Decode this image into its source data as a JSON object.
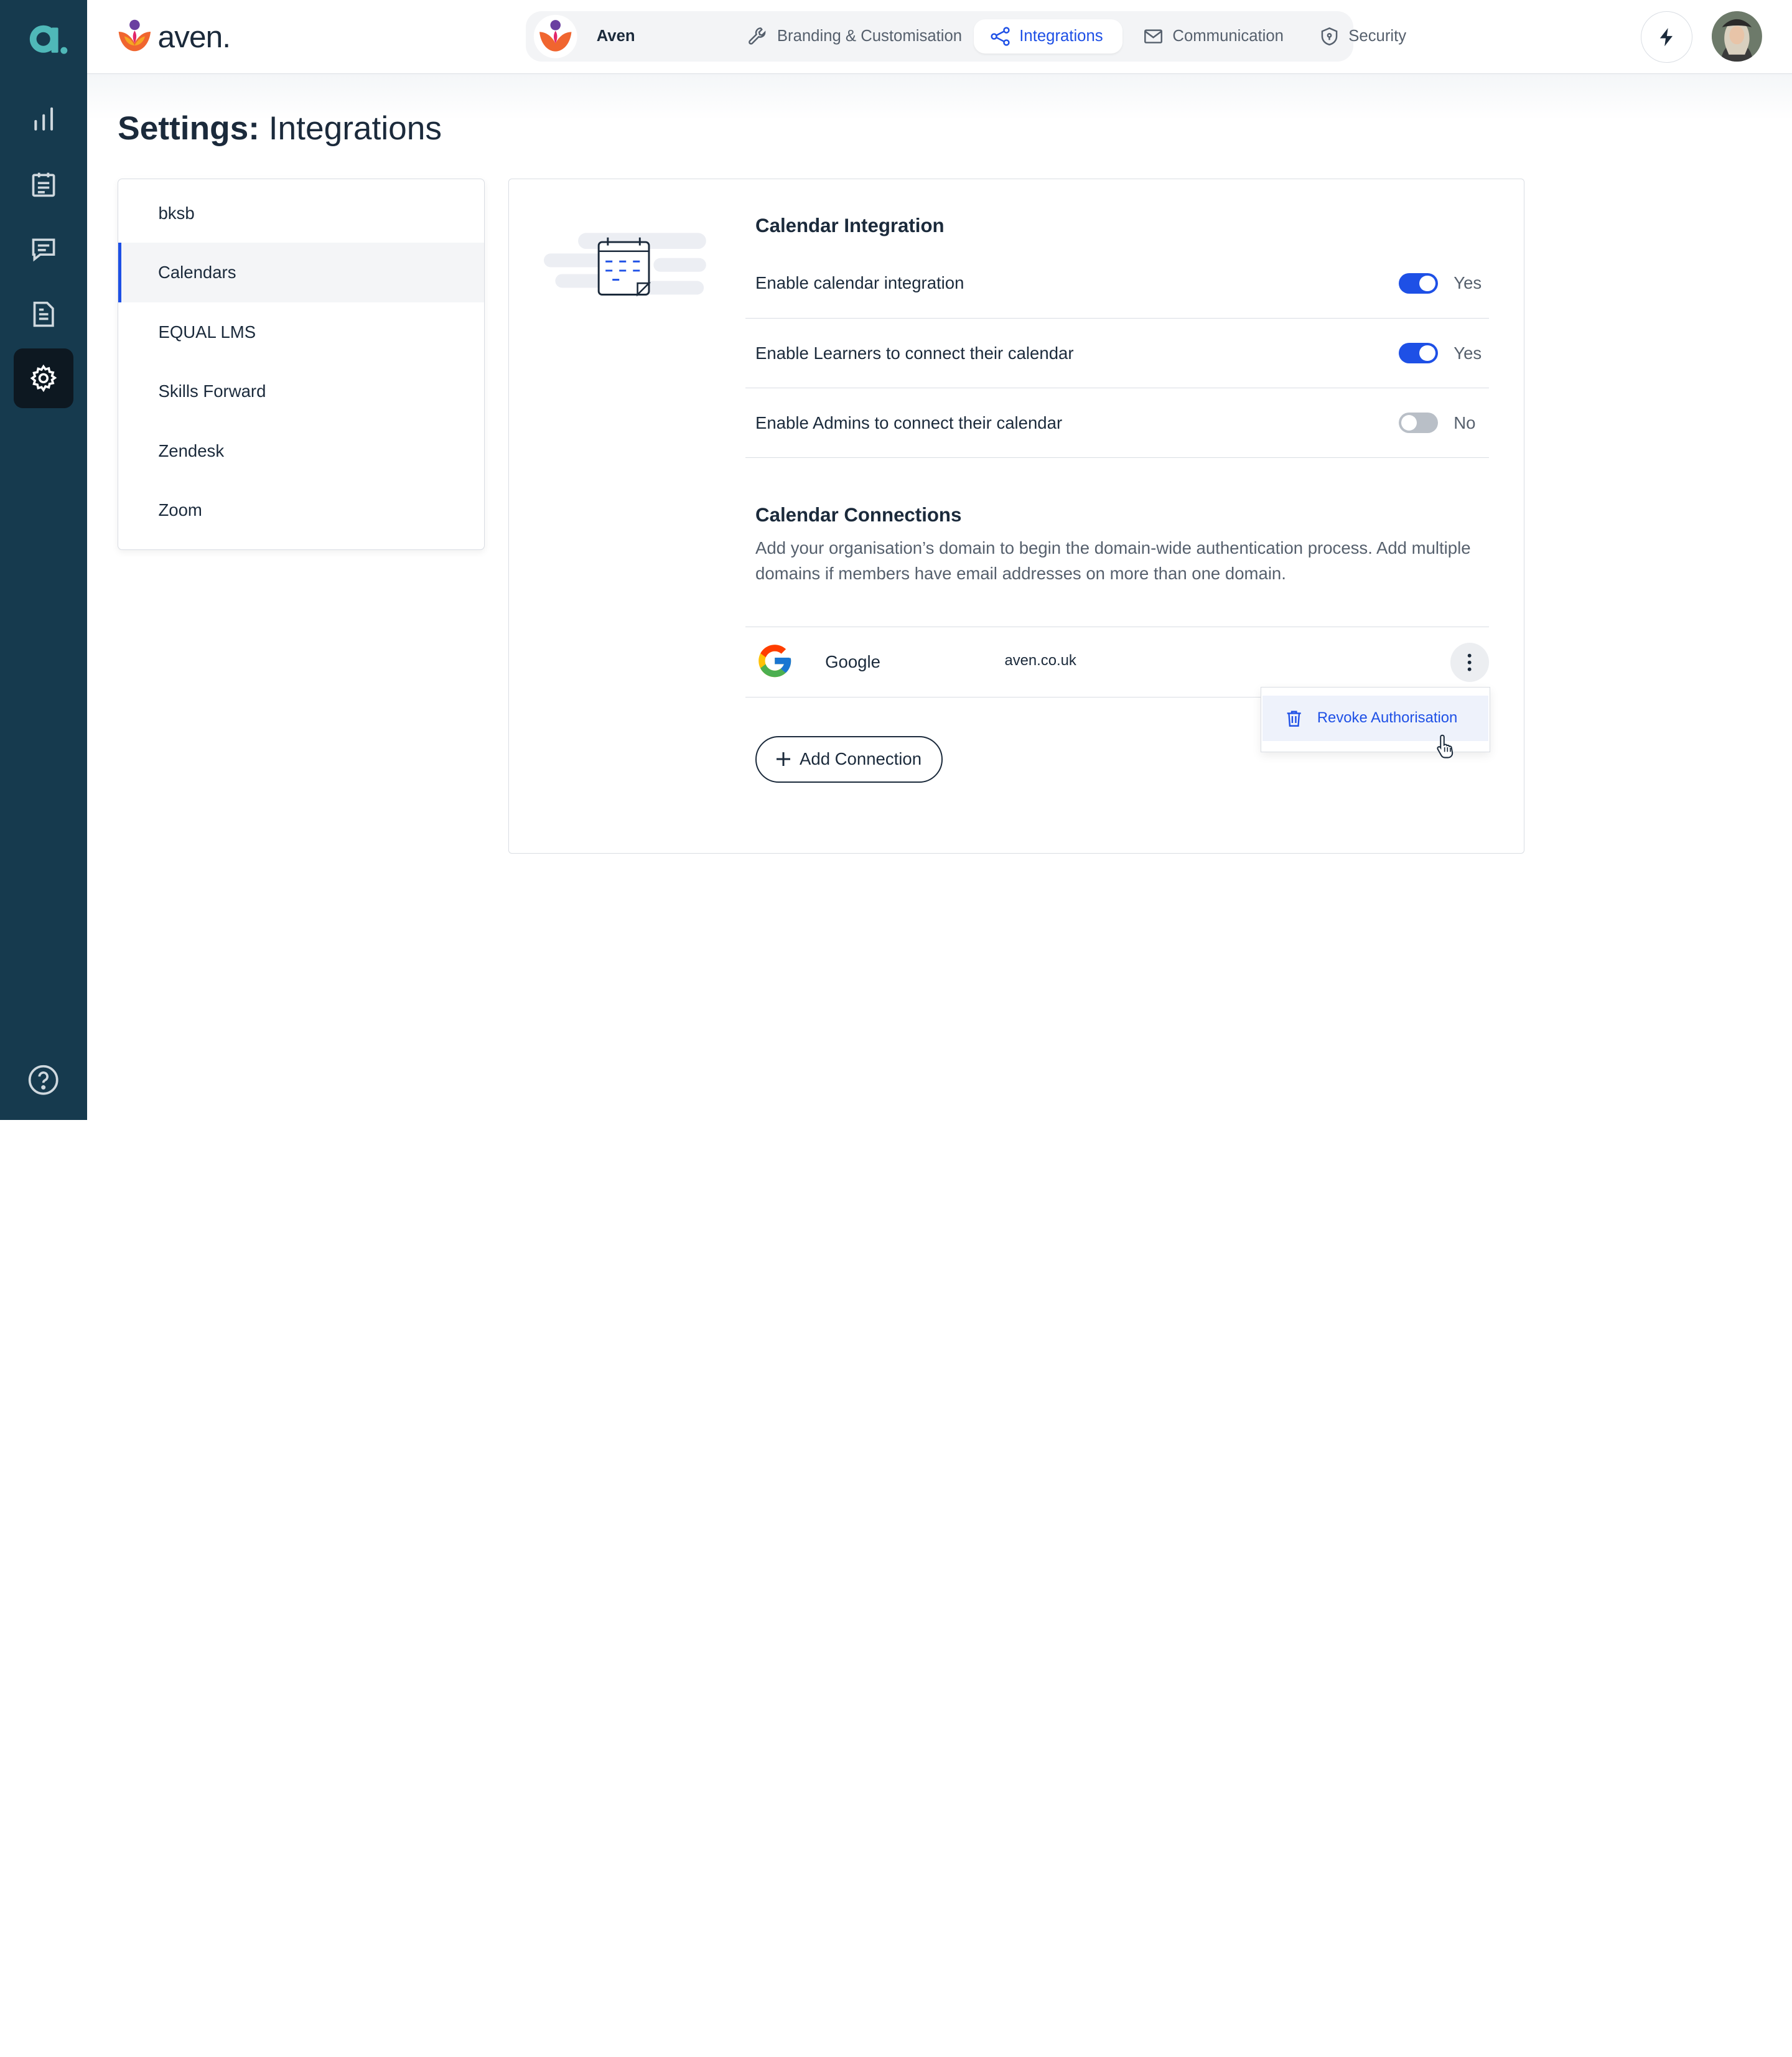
{
  "app": {
    "brand_name": "aven.",
    "rail_logo_letter": "a."
  },
  "rail": {
    "items": [
      {
        "name": "analytics",
        "icon": "bar-chart-icon",
        "active": false
      },
      {
        "name": "assessments",
        "icon": "clipboard-icon",
        "active": false
      },
      {
        "name": "messages",
        "icon": "chat-icon",
        "active": false
      },
      {
        "name": "documents",
        "icon": "document-icon",
        "active": false
      },
      {
        "name": "settings",
        "icon": "gear-icon",
        "active": true
      }
    ],
    "help_icon": "help-icon"
  },
  "header": {
    "tabs": [
      {
        "label": "Aven",
        "icon": "org-logo-icon",
        "active": false
      },
      {
        "label": "Branding & Customisation",
        "icon": "wrench-icon",
        "active": false
      },
      {
        "label": "Integrations",
        "icon": "integrations-icon",
        "active": true
      },
      {
        "label": "Communication",
        "icon": "envelope-icon",
        "active": false
      },
      {
        "label": "Security",
        "icon": "shield-icon",
        "active": false
      }
    ]
  },
  "page": {
    "title_bold": "Settings:",
    "title_rest": " Integrations"
  },
  "subnav": {
    "items": [
      {
        "label": "bksb",
        "active": false
      },
      {
        "label": "Calendars",
        "active": true
      },
      {
        "label": "EQUAL LMS",
        "active": false
      },
      {
        "label": "Skills Forward",
        "active": false
      },
      {
        "label": "Zendesk",
        "active": false
      },
      {
        "label": "Zoom",
        "active": false
      }
    ]
  },
  "calendar": {
    "section_title": "Calendar Integration",
    "settings": [
      {
        "label": "Enable calendar integration",
        "on": true,
        "state_label": "Yes"
      },
      {
        "label": "Enable Learners to connect their calendar",
        "on": true,
        "state_label": "Yes"
      },
      {
        "label": "Enable Admins to connect their calendar",
        "on": false,
        "state_label": "No"
      }
    ],
    "connections_title": "Calendar Connections",
    "connections_desc": "Add your organisation’s domain to begin the domain-wide authentication process. Add multiple domains if members have email addresses on more than one domain.",
    "connections": [
      {
        "provider": "Google",
        "domain": "aven.co.uk"
      }
    ],
    "menu": {
      "item_label": "Revoke Authorisation"
    },
    "add_button_label": "Add Connection"
  },
  "colors": {
    "rail": "#163a4e",
    "accent": "#1e50e6",
    "text": "#1b2a3b"
  }
}
